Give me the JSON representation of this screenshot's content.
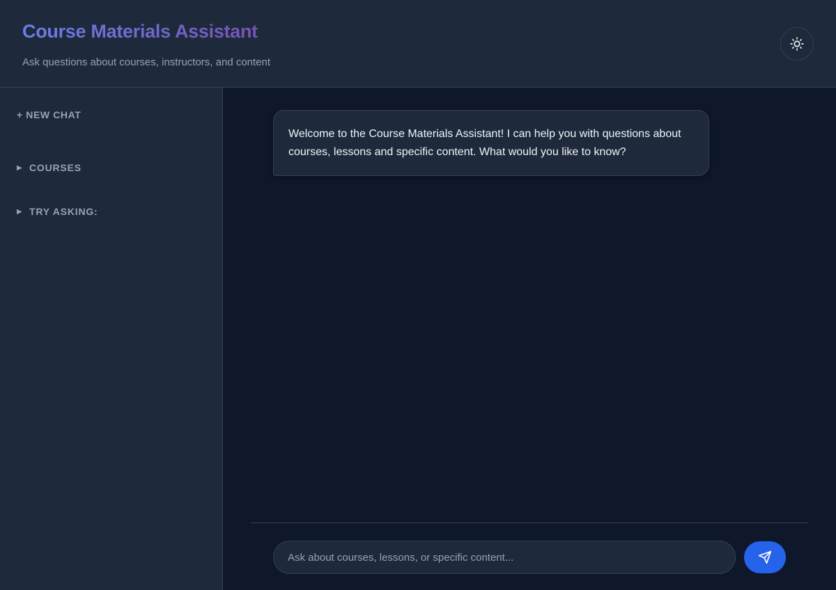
{
  "header": {
    "title": "Course Materials Assistant",
    "subtitle": "Ask questions about courses, instructors, and content",
    "theme_toggle_icon": "sun-icon"
  },
  "sidebar": {
    "new_chat_label": "+ NEW CHAT",
    "sections": [
      {
        "label": "COURSES",
        "expanded": false,
        "icon": "triangle-right-icon"
      },
      {
        "label": "TRY ASKING:",
        "expanded": false,
        "icon": "triangle-right-icon"
      }
    ]
  },
  "chat": {
    "messages": [
      {
        "role": "assistant",
        "text": "Welcome to the Course Materials Assistant! I can help you with questions about courses, lessons and specific content. What would you like to know?"
      }
    ],
    "input": {
      "value": "",
      "placeholder": "Ask about courses, lessons, or specific content..."
    },
    "send_icon": "send-icon"
  },
  "colors": {
    "background": "#0f172a",
    "surface": "#1e293b",
    "border": "#334155",
    "text_primary": "#f1f5f9",
    "text_secondary": "#94a3b8",
    "accent": "#2563eb",
    "title_gradient_start": "#6a7fe8",
    "title_gradient_end": "#7653b3"
  }
}
